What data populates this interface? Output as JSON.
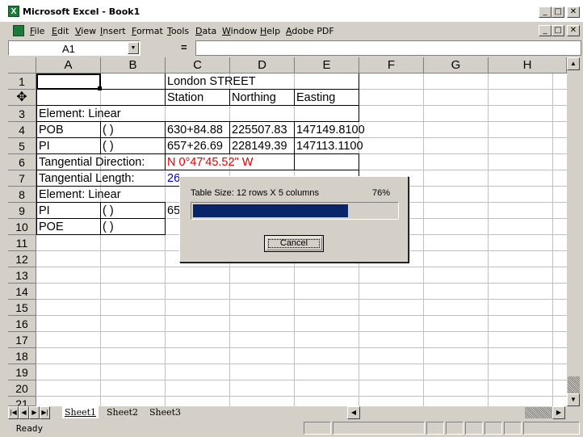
{
  "window": {
    "title": "Microsoft Excel - Book1",
    "minimize": "_",
    "restore": "□",
    "close": "✕"
  },
  "menu": [
    "File",
    "Edit",
    "View",
    "Insert",
    "Format",
    "Tools",
    "Data",
    "Window",
    "Help",
    "Adobe PDF"
  ],
  "formula_bar": {
    "name_box": "A1",
    "equals": "=",
    "formula": ""
  },
  "columns": [
    "A",
    "B",
    "C",
    "D",
    "E",
    "F",
    "G",
    "H"
  ],
  "rows": [
    "1",
    "2",
    "3",
    "4",
    "5",
    "6",
    "7",
    "8",
    "9",
    "10",
    "11",
    "12",
    "13",
    "14",
    "15",
    "16",
    "17",
    "18",
    "19",
    "20",
    "21"
  ],
  "cells": {
    "c1": "London STREET",
    "c2": "Station",
    "d2": "Northing",
    "e2": "Easting",
    "a3": "Element: Linear",
    "a4": "POB",
    "b4": "( )",
    "c4": "630+84.88",
    "d4": "225507.83",
    "e4": "147149.8100",
    "a5": "PI",
    "b5": "( )",
    "c5": "657+26.69",
    "d5": "228149.39",
    "e5": "147113.1100",
    "a6": "Tangential Direction:",
    "c6": "N 0°47'45.52\" W",
    "a7": "Tangential Length:",
    "c7": "26",
    "a8": "Element: Linear",
    "a9": "PI",
    "b9": "( )",
    "c9": "65",
    "a10": "POE",
    "b10": "( )"
  },
  "sheets": [
    "Sheet1",
    "Sheet2",
    "Sheet3"
  ],
  "status": "Ready",
  "dialog": {
    "message": "Table Size: 12 rows X 5 columns",
    "percent_label": "76%",
    "progress": 0.76,
    "cancel": "Cancel"
  },
  "colors": {
    "progress_fill": "#0a246a",
    "red_text": "#dd0000",
    "blue_text": "#0000cc"
  }
}
